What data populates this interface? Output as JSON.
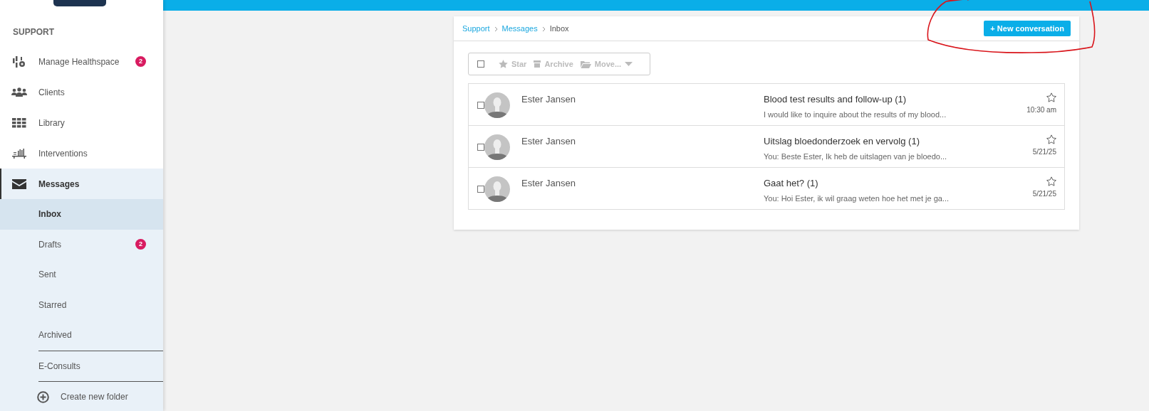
{
  "sidebar": {
    "heading": "SUPPORT",
    "items": [
      {
        "label": "Manage Healthspace",
        "badge": "2",
        "selected": false
      },
      {
        "label": "Clients",
        "selected": false
      },
      {
        "label": "Library",
        "selected": false
      },
      {
        "label": "Interventions",
        "selected": false
      },
      {
        "label": "Messages",
        "selected": true,
        "expanded": true,
        "children": [
          {
            "label": "Inbox",
            "selected": true
          },
          {
            "label": "Drafts",
            "badge": "2",
            "selected": false
          },
          {
            "label": "Sent",
            "selected": false
          },
          {
            "label": "Starred",
            "selected": false
          },
          {
            "label": "Archived",
            "selected": false
          },
          {
            "label": "E-Consults",
            "selected": false
          }
        ]
      }
    ],
    "create_folder": "Create new folder"
  },
  "breadcrumb": [
    {
      "label": "Support",
      "link": true
    },
    {
      "label": "Messages",
      "link": true
    },
    {
      "label": "Inbox",
      "link": false
    }
  ],
  "new_button": {
    "icon": "+",
    "label": "New conversation"
  },
  "toolbar": {
    "select_all_checked": false,
    "star": "Star",
    "archive": "Archive",
    "move": "Move..."
  },
  "messages": [
    {
      "checked": false,
      "starred": false,
      "sender": "Ester Jansen",
      "subject": "Blood test results and follow-up (1)",
      "preview": "I would like to inquire about the results of my blood...",
      "time": "10:30 am"
    },
    {
      "checked": false,
      "starred": false,
      "sender": "Ester Jansen",
      "subject": "Uitslag bloedonderzoek en vervolg (1)",
      "preview": "You: Beste Ester, Ik heb de uitslagen van je bloedo...",
      "time": "5/21/25"
    },
    {
      "checked": false,
      "starred": false,
      "sender": "Ester Jansen",
      "subject": "Gaat het? (1)",
      "preview": "You: Hoi Ester, ik wil graag weten hoe het met je ga...",
      "time": "5/21/25"
    }
  ]
}
